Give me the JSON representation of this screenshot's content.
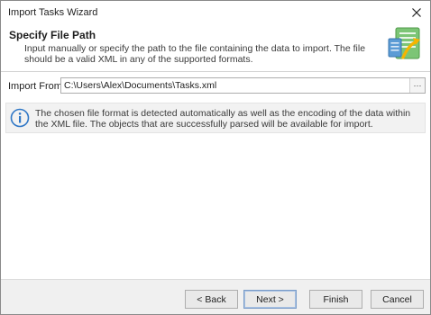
{
  "window": {
    "title": "Import Tasks Wizard",
    "close_icon": "close-icon"
  },
  "header": {
    "title": "Specify File Path",
    "description": "Input manually or specify the path to the file containing the data to import. The file should be a valid XML in any of the supported formats.",
    "icon": "import-document-icon"
  },
  "form": {
    "import_label": "Import From:",
    "path_value": "C:\\Users\\Alex\\Documents\\Tasks.xml",
    "browse_label": "···"
  },
  "info": {
    "icon": "info-icon",
    "text": "The chosen file format is detected automatically as well as the encoding of the data within the XML file. The objects that are successfully parsed will be available for import."
  },
  "footer": {
    "back_label": "< Back",
    "next_label": "Next >",
    "finish_label": "Finish",
    "cancel_label": "Cancel"
  },
  "colors": {
    "accent_blue": "#3d7cc9",
    "info_blue": "#2f77c6",
    "icon_green": "#5cb85c"
  }
}
